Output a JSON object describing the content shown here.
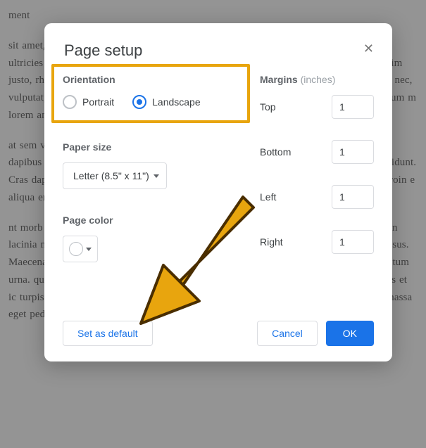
{
  "bg_paragraphs": [
    "ment",
    " sit amet, consectetur adipiscing elit. Aenean commodo ligula eget ce pulvinar, magna a ultricies suscipit, mi odio porttitor nisl, sed eros s imperdiet et, dictum vel, lacus. In enim justo, rhoncus ut, imperdiet atique malesu enim. Donec pede justo, fringilla vel, aliquet nec, vulputat, orci. In portt ellus ut enim. Donec quam felis, ultricies nec, pellentesque at, tium m lorem ante, dapibus in, viverra quis, feugiat a, tellus.",
    "at sem vent. Aenean vulputate eleifend tellus. Aenean leo ligula, disse entesque ant vel, dapibus id, mattis vel, nisi. Curabitur ligula felis e purus i lesuada pretium. Integer tincidunt. Cras dapibus. Vivam, lectus at. Etiam itae sapien libero, cursus a, commodo eget, le. Proin e aliqua entum semper nisi. Aenean vulputate eleifend tellus.",
    "nt morb is faucibus. Ned quam nunc, blandit vel, luctus pulvinar, nc ac odio dolor enean lacinia magna vel enim. Cum sociis natoque ngittis porttitor c rutrum quam. Aliquam risus. Maecenas eget urna sag augue as non l tibulum iaculis lacinia est. Proin dictum elementum urna. quam et trices lobortis eros. Pellentesque habitant morbi tristique senectus et netus et ic turpis egestas. Proin semper, ante vitae sollicitudin posuere, metus quam iaculis nc massa eget pede. Sed velit urna, interdum vel, ultricies vel, faucibus at, quam."
  ],
  "dialog": {
    "title": "Page setup",
    "orientation": {
      "label": "Orientation",
      "portrait": "Portrait",
      "landscape": "Landscape",
      "selected": "landscape"
    },
    "paper_size": {
      "label": "Paper size",
      "value": "Letter (8.5\" x 11\")"
    },
    "page_color": {
      "label": "Page color"
    },
    "margins": {
      "label": "Margins",
      "unit": "(inches)",
      "top": {
        "label": "Top",
        "value": "1"
      },
      "bottom": {
        "label": "Bottom",
        "value": "1"
      },
      "left": {
        "label": "Left",
        "value": "1"
      },
      "right": {
        "label": "Right",
        "value": "1"
      }
    },
    "buttons": {
      "set_default": "Set as default",
      "cancel": "Cancel",
      "ok": "OK"
    }
  }
}
